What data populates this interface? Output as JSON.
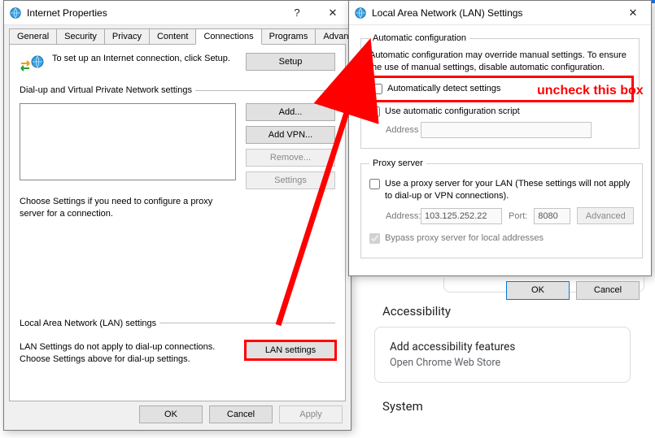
{
  "ip": {
    "title": "Internet Properties",
    "tabs": [
      "General",
      "Security",
      "Privacy",
      "Content",
      "Connections",
      "Programs",
      "Advanced"
    ],
    "activeTab": 4,
    "setup_text": "To set up an Internet connection, click Setup.",
    "setup_btn": "Setup",
    "group_dialup": "Dial-up and Virtual Private Network settings",
    "btn_add": "Add...",
    "btn_addvpn": "Add VPN...",
    "btn_remove": "Remove...",
    "btn_settings": "Settings",
    "dialup_help": "Choose Settings if you need to configure a proxy server for a connection.",
    "group_lan": "Local Area Network (LAN) settings",
    "lan_help": "LAN Settings do not apply to dial-up connections. Choose Settings above for dial-up settings.",
    "btn_lan": "LAN settings",
    "btn_ok": "OK",
    "btn_cancel": "Cancel",
    "btn_apply": "Apply"
  },
  "lan": {
    "title": "Local Area Network (LAN) Settings",
    "group_auto": "Automatic configuration",
    "auto_desc": "Automatic configuration may override manual settings.  To ensure the use of manual settings, disable automatic configuration.",
    "chk_autodetect": "Automatically detect settings",
    "chk_autoscript": "Use automatic configuration script",
    "lbl_address": "Address",
    "group_proxy": "Proxy server",
    "chk_proxy": "Use a proxy server for your LAN (These settings will not apply to dial-up or VPN connections).",
    "lbl_proxy_addr": "Address:",
    "val_proxy_addr": "103.125.252.22",
    "lbl_proxy_port": "Port:",
    "val_proxy_port": "8080",
    "btn_advanced": "Advanced",
    "chk_bypass": "Bypass proxy server for local addresses",
    "btn_ok": "OK",
    "btn_cancel": "Cancel"
  },
  "annotation": {
    "uncheck": "uncheck this box"
  },
  "chrome": {
    "section": "Accessibility",
    "card_t1": "Add accessibility features",
    "card_t2": "Open Chrome Web Store",
    "section2": "System"
  }
}
